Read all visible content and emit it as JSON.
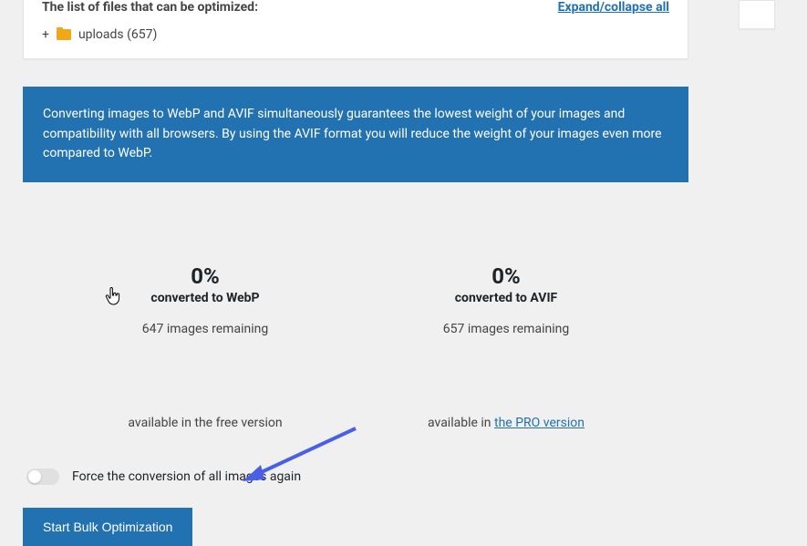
{
  "file_list": {
    "header": "The list of files that can be optimized:",
    "expand_link": "Expand/collapse all",
    "folder_name": "uploads (657)"
  },
  "info_banner": "Converting images to WebP and AVIF simultaneously guarantees the lowest weight of your images and compatibility with all browsers. By using the AVIF format you will reduce the weight of your images even more compared to WebP.",
  "stats": {
    "webp": {
      "percent": "0%",
      "label": "converted to WebP",
      "remaining": "647 images remaining",
      "availability_prefix": "available in the free version"
    },
    "avif": {
      "percent": "0%",
      "label": "converted to AVIF",
      "remaining": "657 images remaining",
      "availability_prefix": "available in ",
      "availability_link": "the PRO version"
    }
  },
  "toggle": {
    "label": "Force the conversion of all images again"
  },
  "buttons": {
    "start": "Start Bulk Optimization"
  }
}
